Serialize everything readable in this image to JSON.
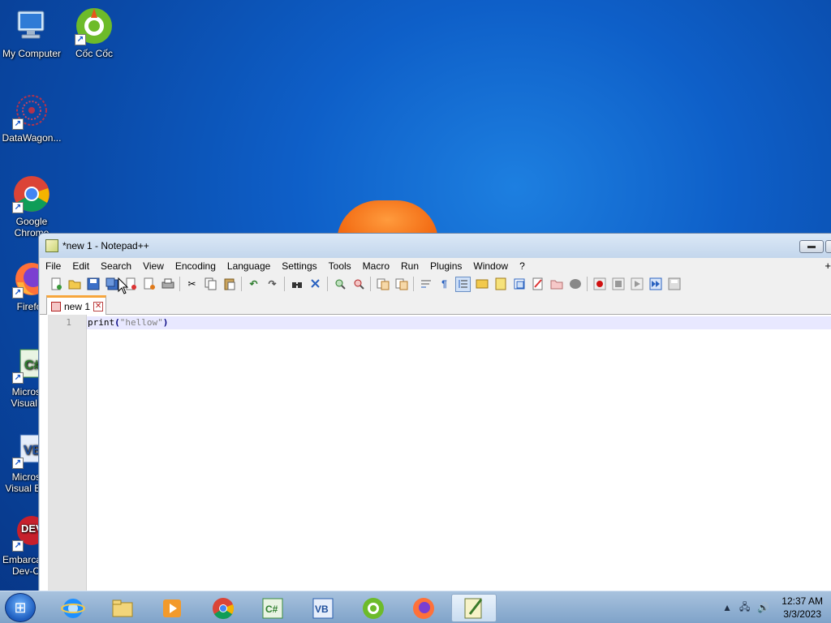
{
  "desktop": {
    "icons": [
      {
        "label": "My Computer"
      },
      {
        "label": "Cốc Cốc"
      },
      {
        "label": "DataWagon..."
      },
      {
        "label": "Google Chrome"
      },
      {
        "label": "Firefox"
      },
      {
        "label": "Microsoft Visual C#"
      },
      {
        "label": "Microsoft Visual Basic"
      },
      {
        "label": "Embarcadero Dev-C++"
      }
    ]
  },
  "window": {
    "title": "*new 1 - Notepad++",
    "menu": [
      "File",
      "Edit",
      "Search",
      "View",
      "Encoding",
      "Language",
      "Settings",
      "Tools",
      "Macro",
      "Run",
      "Plugins",
      "Window",
      "?"
    ],
    "menu_plus": "+",
    "tab_label": "new 1",
    "editor": {
      "line_number": "1",
      "code_func": "print",
      "code_open": "(",
      "code_string": "\"hellow\"",
      "code_close": ")"
    }
  },
  "taskbar": {
    "clock_time": "12:37 AM",
    "clock_date": "3/3/2023"
  },
  "colors": {
    "tab_accent": "#f7a63c",
    "current_line": "#e8e8ff",
    "desktop_blue": "#0e5fc8"
  }
}
